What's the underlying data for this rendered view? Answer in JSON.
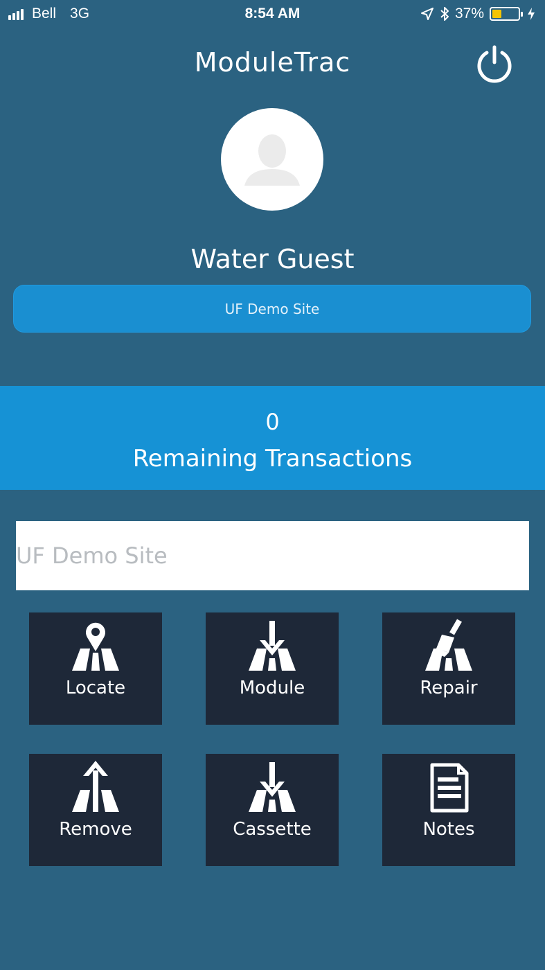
{
  "status_bar": {
    "carrier": "Bell",
    "network": "3G",
    "time": "8:54 AM",
    "battery_percent": "37%",
    "battery_level": 0.37,
    "icons": [
      "signal-icon",
      "location-icon",
      "bluetooth-icon",
      "battery-icon",
      "charging-icon"
    ]
  },
  "header": {
    "title": "ModuleTrac",
    "power_icon": "power-icon"
  },
  "profile": {
    "name": "Water Guest",
    "avatar_icon": "user-silhouette-icon"
  },
  "site_button": {
    "label": "UF Demo Site"
  },
  "transactions": {
    "count": "0",
    "label": "Remaining Transactions"
  },
  "site_input": {
    "placeholder": "UF Demo Site"
  },
  "actions": [
    {
      "label": "Locate",
      "icon": "locate-road-pin-icon"
    },
    {
      "label": "Module",
      "icon": "module-road-arrow-down-icon"
    },
    {
      "label": "Repair",
      "icon": "repair-road-brush-icon"
    },
    {
      "label": "Remove",
      "icon": "remove-road-arrow-up-icon"
    },
    {
      "label": "Cassette",
      "icon": "cassette-road-arrow-down-icon"
    },
    {
      "label": "Notes",
      "icon": "notes-document-icon"
    }
  ],
  "colors": {
    "background": "#2b6281",
    "accent_blue": "#1692d5",
    "tile_bg": "#1e2838",
    "battery_fill": "#f5c400"
  }
}
